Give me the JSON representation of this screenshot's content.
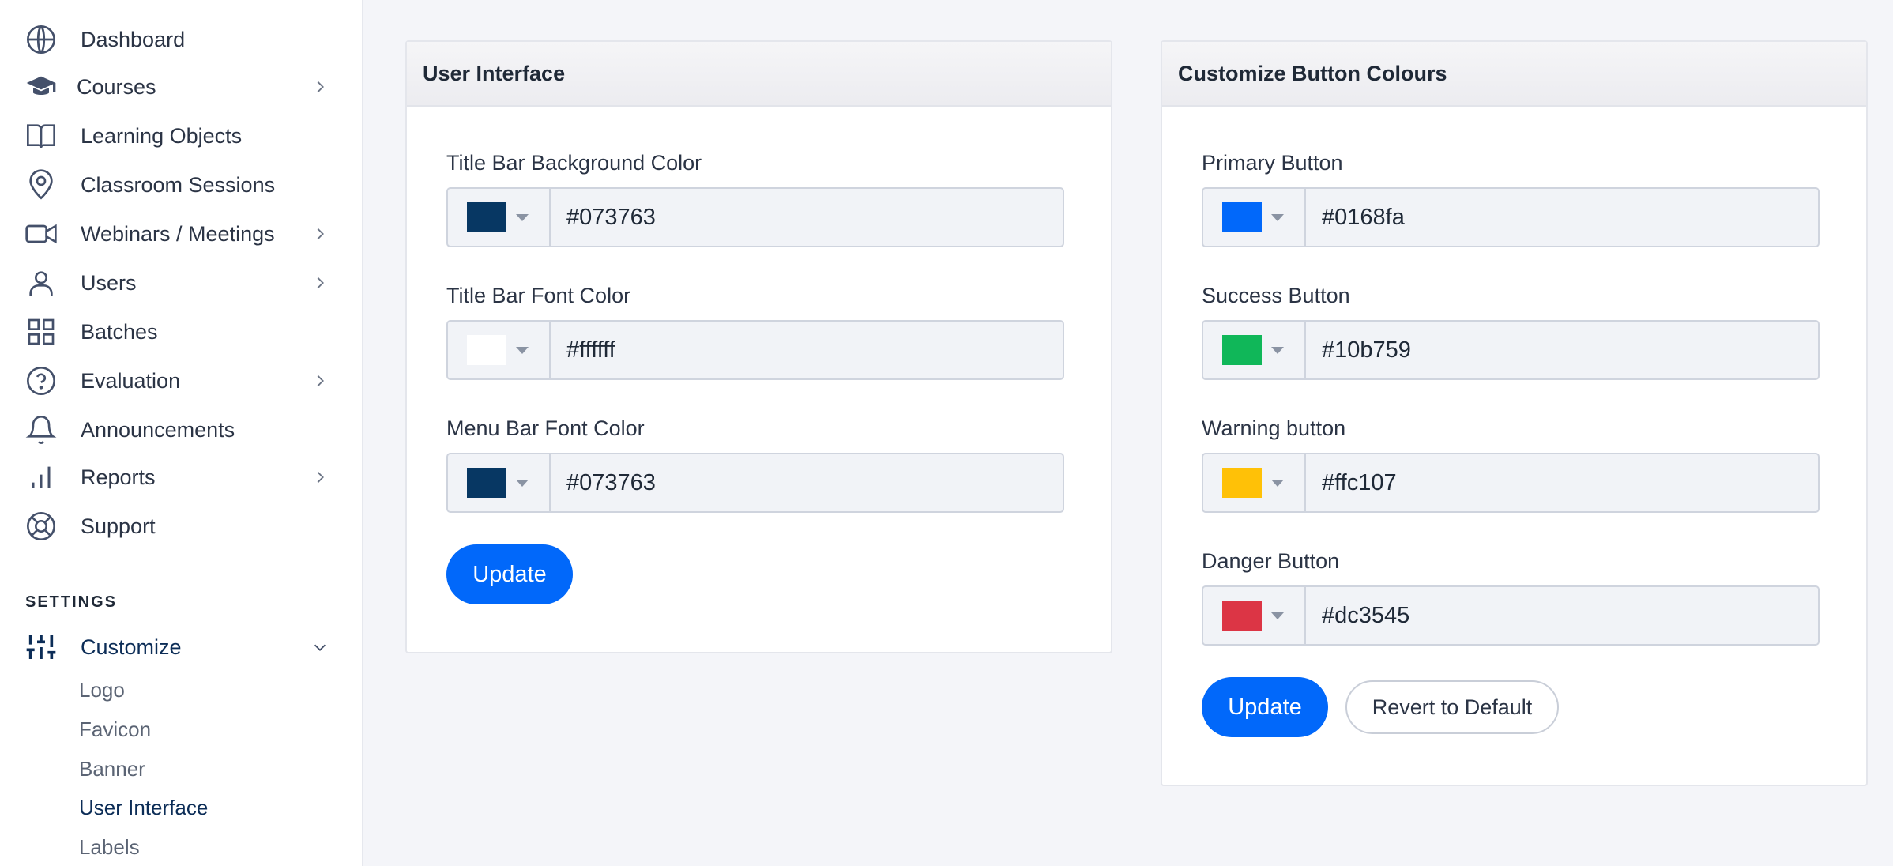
{
  "sidebar": {
    "items": [
      {
        "label": "Dashboard",
        "icon": "globe-icon"
      },
      {
        "label": "Courses",
        "icon": "graduation-cap-icon"
      },
      {
        "label": "Learning Objects",
        "icon": "book-icon"
      },
      {
        "label": "Classroom Sessions",
        "icon": "map-pin-icon"
      },
      {
        "label": "Webinars / Meetings",
        "icon": "video-icon"
      },
      {
        "label": "Users",
        "icon": "user-icon"
      },
      {
        "label": "Batches",
        "icon": "grid-icon"
      },
      {
        "label": "Evaluation",
        "icon": "help-circle-icon"
      },
      {
        "label": "Announcements",
        "icon": "bell-icon"
      },
      {
        "label": "Reports",
        "icon": "bar-chart-icon"
      },
      {
        "label": "Support",
        "icon": "life-buoy-icon"
      }
    ],
    "settings_title": "SETTINGS",
    "customize": {
      "label": "Customize",
      "icon": "sliders-icon"
    },
    "customize_sub": [
      "Logo",
      "Favicon",
      "Banner",
      "User Interface",
      "Labels"
    ]
  },
  "ui_card": {
    "title": "User Interface",
    "fields": [
      {
        "label": "Title Bar Background Color",
        "value": "#073763",
        "swatch": "#073763"
      },
      {
        "label": "Title Bar Font Color",
        "value": "#ffffff",
        "swatch": "#ffffff"
      },
      {
        "label": "Menu Bar Font Color",
        "value": "#073763",
        "swatch": "#073763"
      }
    ],
    "update_label": "Update"
  },
  "buttons_card": {
    "title": "Customize Button Colours",
    "fields": [
      {
        "label": "Primary Button",
        "value": "#0168fa",
        "swatch": "#0168fa"
      },
      {
        "label": "Success Button",
        "value": "#10b759",
        "swatch": "#10b759"
      },
      {
        "label": "Warning button",
        "value": "#ffc107",
        "swatch": "#ffc107"
      },
      {
        "label": "Danger Button",
        "value": "#dc3545",
        "swatch": "#dc3545"
      }
    ],
    "update_label": "Update",
    "revert_label": "Revert to Default"
  },
  "colors": {
    "accent": "#0168fa",
    "active_nav": "#0c2d57"
  }
}
